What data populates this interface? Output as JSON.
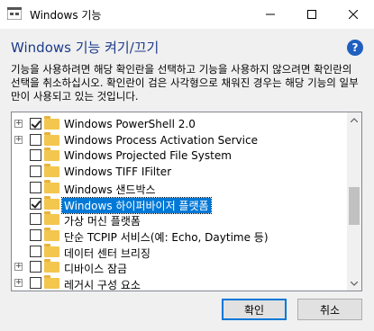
{
  "window": {
    "title": "Windows 기능",
    "heading": "Windows 기능 켜기/끄기",
    "description": "기능을 사용하려면 해당 확인란을 선택하고 기능을 사용하지 않으려면 확인란의 선택을 취소하십시오. 확인란이 검은 사각형으로 채워진 경우는 해당 기능의 일부만이 사용되고 있는 것입니다."
  },
  "features": [
    {
      "label": "Windows PowerShell 2.0",
      "expandable": true,
      "checked": true
    },
    {
      "label": "Windows Process Activation Service",
      "expandable": true,
      "checked": false
    },
    {
      "label": "Windows Projected File System",
      "expandable": false,
      "checked": false
    },
    {
      "label": "Windows TIFF IFilter",
      "expandable": false,
      "checked": false
    },
    {
      "label": "Windows 샌드박스",
      "expandable": false,
      "checked": false
    },
    {
      "label": "Windows 하이퍼바이저 플랫폼",
      "expandable": false,
      "checked": true,
      "selected": true
    },
    {
      "label": "가상 머신 플랫폼",
      "expandable": false,
      "checked": false
    },
    {
      "label": "단순 TCPIP 서비스(예: Echo, Daytime 등)",
      "expandable": false,
      "checked": false
    },
    {
      "label": "데이터 센터 브리징",
      "expandable": false,
      "checked": false
    },
    {
      "label": "디바이스 잠금",
      "expandable": true,
      "checked": false
    },
    {
      "label": "레거시 구성 요소",
      "expandable": true,
      "checked": false
    }
  ],
  "buttons": {
    "ok": "확인",
    "cancel": "취소"
  },
  "icons": {
    "help": "?",
    "minimize": "minimize-icon",
    "maximize": "maximize-icon",
    "close": "close-icon"
  }
}
